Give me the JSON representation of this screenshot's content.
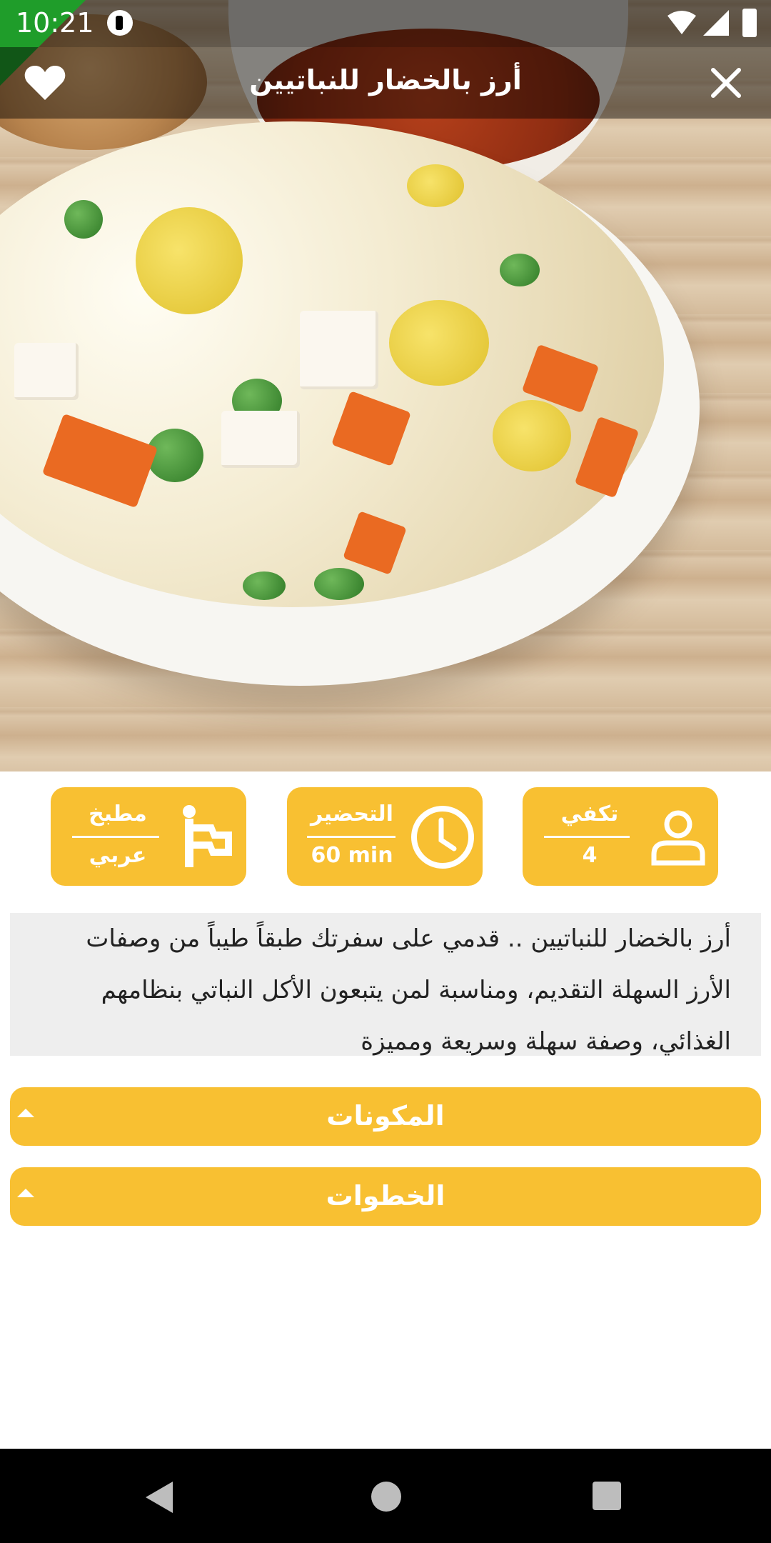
{
  "status_bar": {
    "time": "10:21"
  },
  "header": {
    "title": "أرز بالخضار للنباتيين"
  },
  "info_cards": [
    {
      "label": "تكفي",
      "value": "4",
      "icon": "person-icon"
    },
    {
      "label": "التحضير",
      "value": "60 min",
      "icon": "clock-icon"
    },
    {
      "label": "مطبخ",
      "value": "عربي",
      "icon": "flag-icon"
    }
  ],
  "description": {
    "lines": [
      "أرز بالخضار للنباتيين .. قدمي على سفرتك طبقاً طيباً من وصفات",
      "الأرز السهلة التقديم، ومناسبة لمن يتبعون الأكل النباتي بنظامهم",
      "الغذائي، وصفة سهلة وسريعة ومميزة"
    ]
  },
  "sections": [
    {
      "label": "المكونات"
    },
    {
      "label": "الخطوات"
    }
  ],
  "colors": {
    "accent": "#f8c032",
    "description_bg": "#eeeeee"
  }
}
